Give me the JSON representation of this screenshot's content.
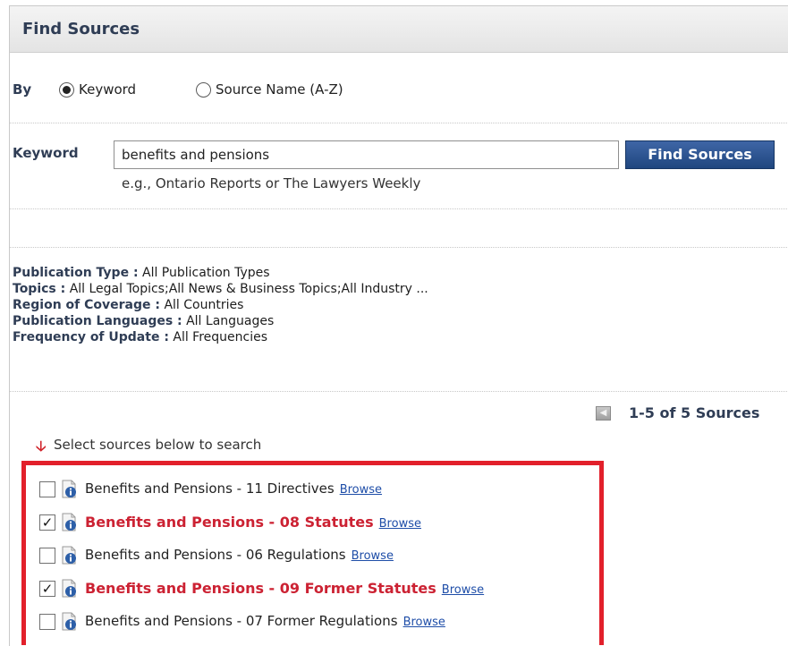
{
  "panel": {
    "title": "Find Sources"
  },
  "search_by": {
    "label": "By",
    "options": [
      {
        "label": "Keyword",
        "selected": true
      },
      {
        "label": "Source Name (A-Z)",
        "selected": false
      }
    ]
  },
  "keyword": {
    "label": "Keyword",
    "value": "benefits and pensions",
    "hint": "e.g., Ontario Reports or The Lawyers Weekly",
    "button_label": "Find Sources"
  },
  "filters": [
    {
      "label": "Publication Type :",
      "value": "All Publication Types"
    },
    {
      "label": "Topics :",
      "value": "All Legal Topics;All News & Business Topics;All Industry ..."
    },
    {
      "label": "Region of Coverage :",
      "value": "All Countries"
    },
    {
      "label": "Publication Languages :",
      "value": "All Languages"
    },
    {
      "label": "Frequency of Update :",
      "value": "All Frequencies"
    }
  ],
  "pager": {
    "text": "1-5 of 5 Sources"
  },
  "results_hint": "Select sources below to search",
  "sources": [
    {
      "name": "Benefits and Pensions - 11 Directives",
      "checked": false,
      "browse": "Browse"
    },
    {
      "name": "Benefits and Pensions - 08 Statutes",
      "checked": true,
      "browse": "Browse"
    },
    {
      "name": "Benefits and Pensions - 06 Regulations",
      "checked": false,
      "browse": "Browse"
    },
    {
      "name": "Benefits and Pensions - 09 Former Statutes",
      "checked": true,
      "browse": "Browse"
    },
    {
      "name": "Benefits and Pensions - 07 Former Regulations",
      "checked": false,
      "browse": "Browse"
    }
  ],
  "colors": {
    "selected_text": "#cc2233",
    "highlight_border": "#e2202b",
    "button_bg": "#2b5290",
    "link": "#1f4ea8"
  }
}
